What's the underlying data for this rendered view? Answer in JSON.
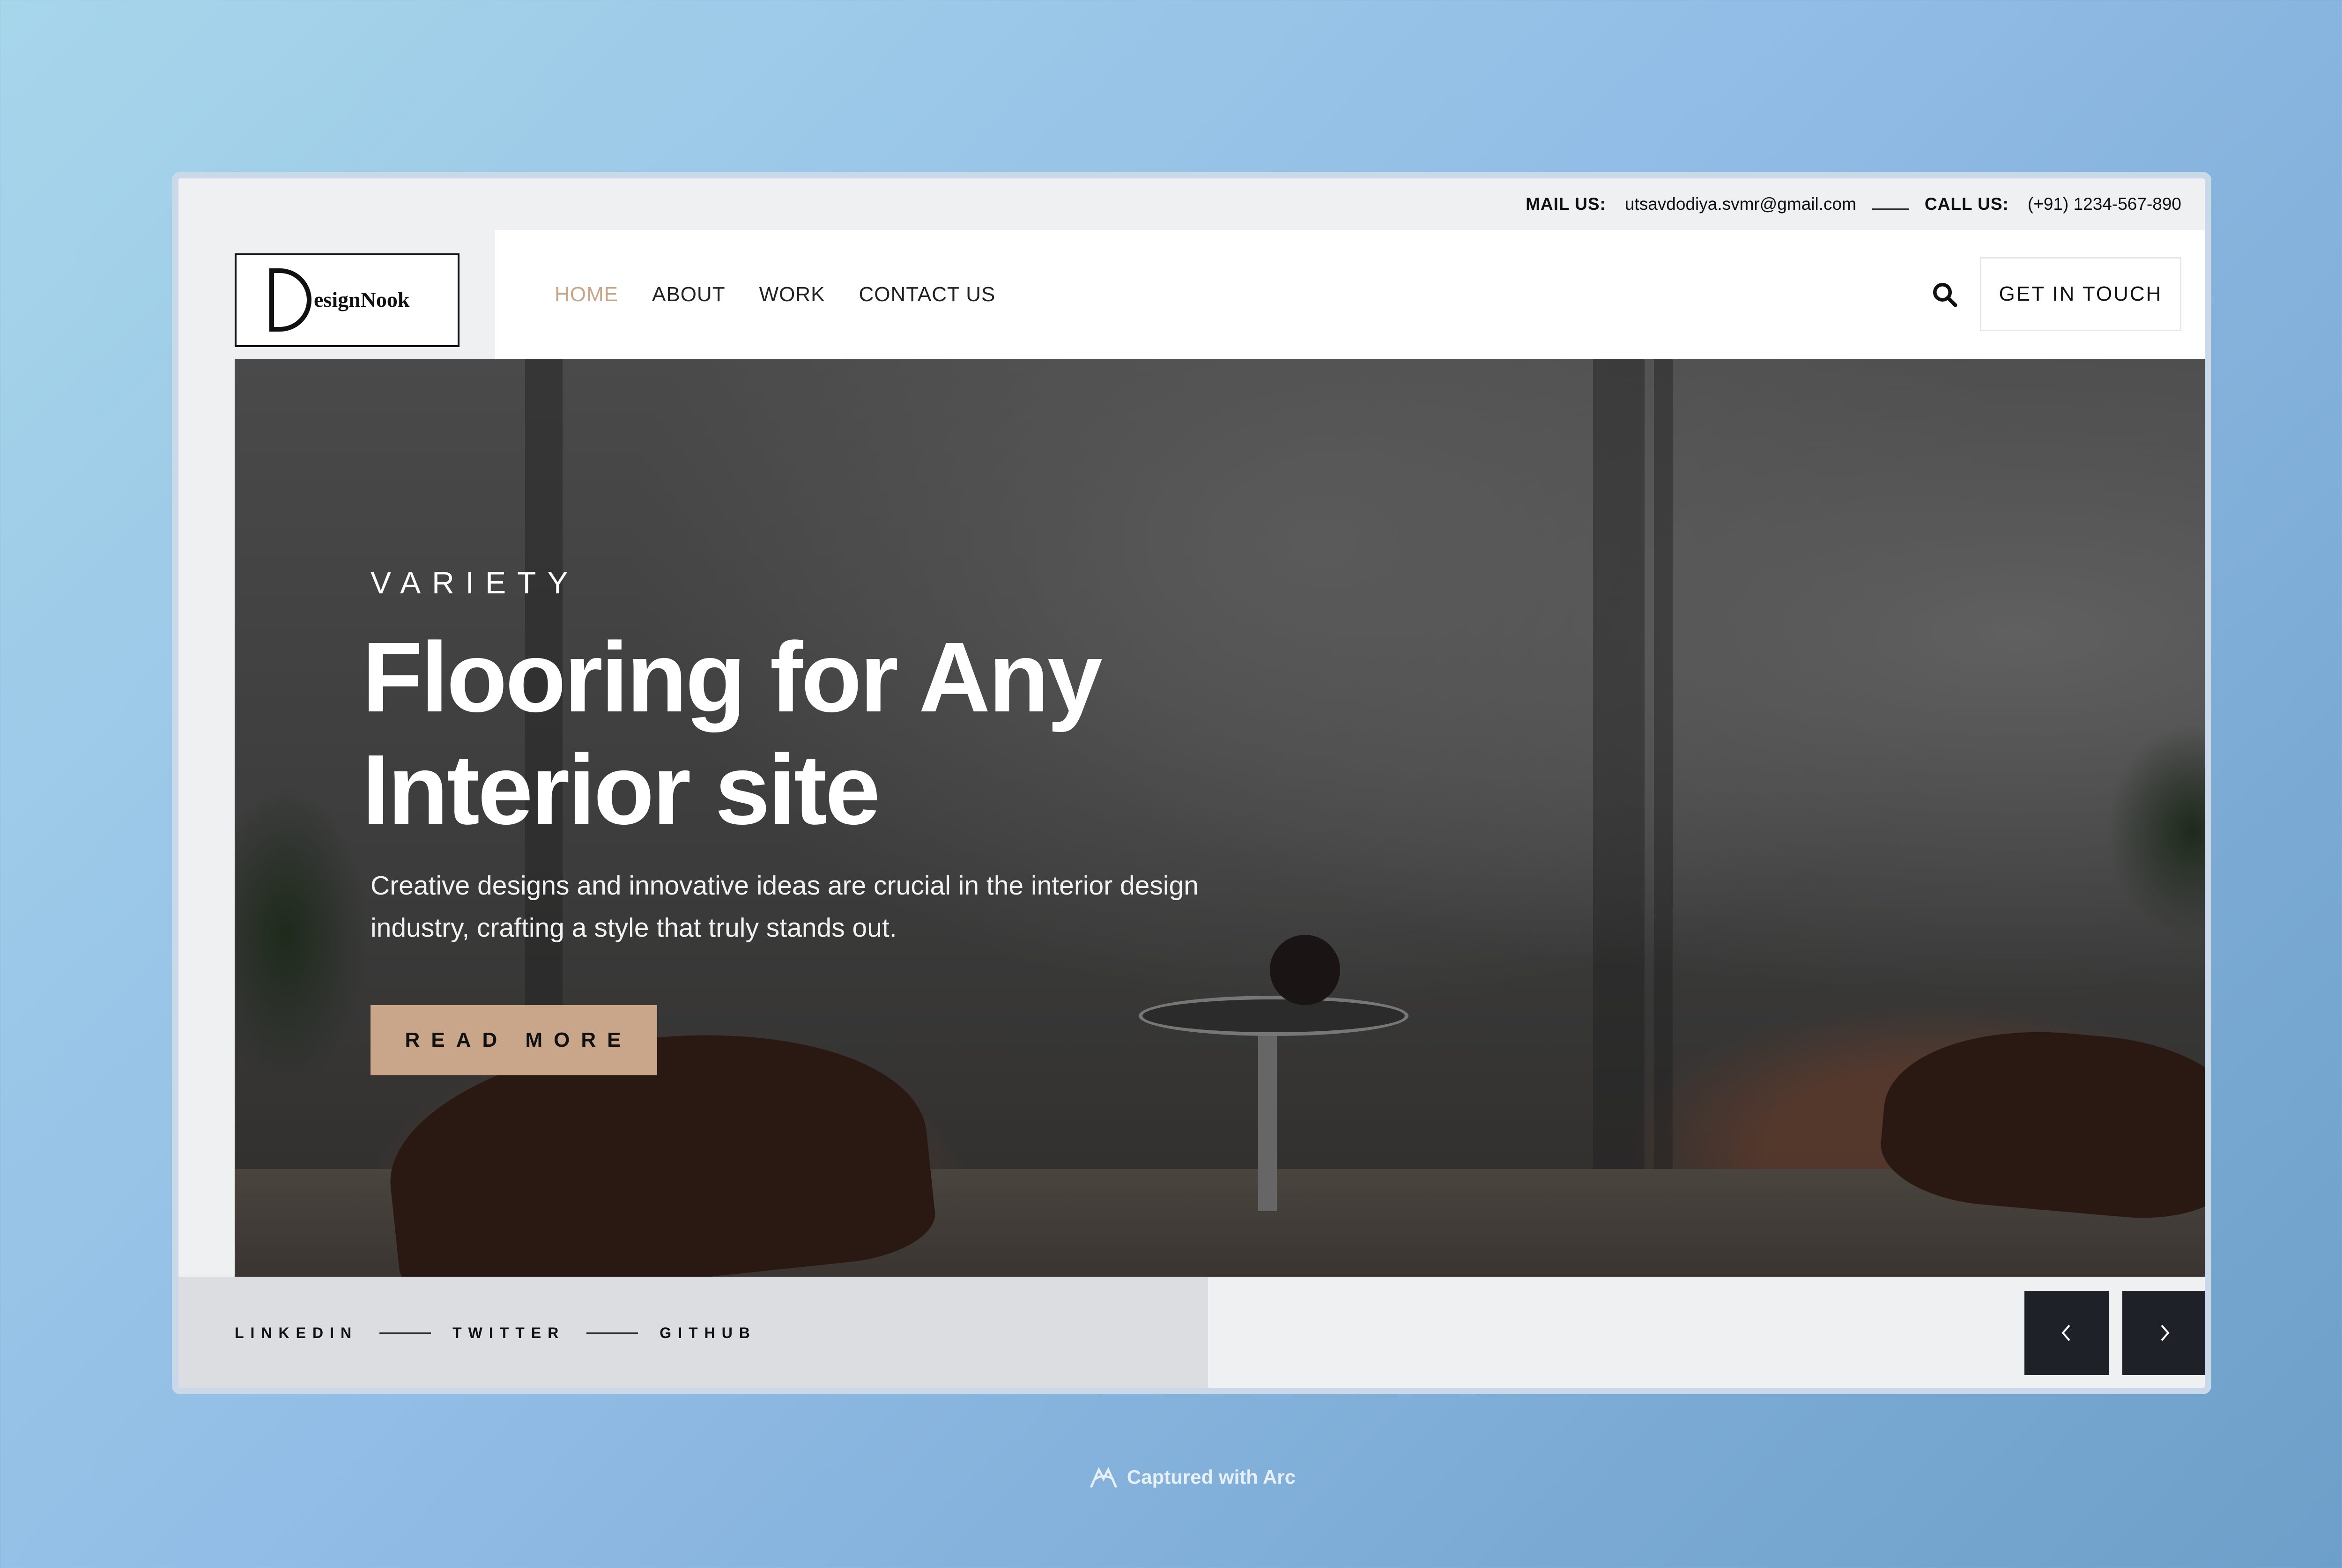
{
  "topbar": {
    "mail_label": "MAIL US:",
    "mail_value": "utsavdodiya.svmr@gmail.com",
    "call_label": "CALL US:",
    "call_value": "(+91) 1234-567-890"
  },
  "logo": {
    "text": "esignNook",
    "letter": "D"
  },
  "nav": {
    "items": [
      {
        "label": "HOME",
        "active": true
      },
      {
        "label": "ABOUT"
      },
      {
        "label": "WORK"
      },
      {
        "label": "CONTACT US"
      }
    ],
    "active_color": "#c9a58a"
  },
  "header": {
    "cta_label": "GET IN TOUCH",
    "search_icon": "search-icon"
  },
  "hero": {
    "eyebrow": "VARIETY",
    "title_line1": "Flooring for Any",
    "title_line2": "Interior site",
    "description": "Creative designs and innovative ideas are crucial in the interior design industry, crafting a style that truly stands out.",
    "button_label": "READ MORE",
    "button_color": "#c9a58a"
  },
  "social": {
    "links": [
      "LINKEDIN",
      "TWITTER",
      "GITHUB"
    ]
  },
  "slider": {
    "prev_icon": "chevron-left-icon",
    "next_icon": "chevron-right-icon"
  },
  "caption": {
    "text": "Captured with Arc"
  }
}
